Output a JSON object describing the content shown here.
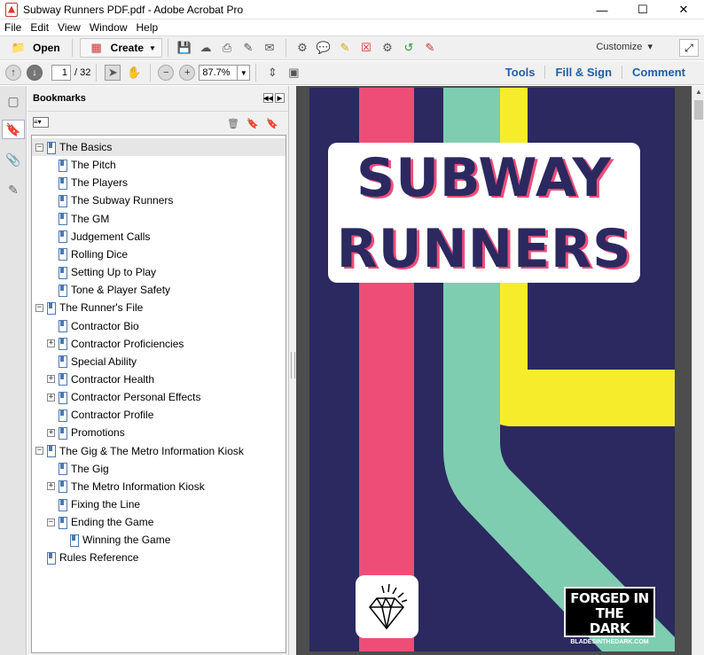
{
  "window": {
    "title": "Subway Runners PDF.pdf - Adobe Acrobat Pro"
  },
  "menu": [
    "File",
    "Edit",
    "View",
    "Window",
    "Help"
  ],
  "toolbar": {
    "open_label": "Open",
    "create_label": "Create",
    "customize_label": "Customize"
  },
  "nav": {
    "current_page": "1",
    "total_pages": "/ 32",
    "zoom": "87.7%"
  },
  "right_links": [
    "Tools",
    "Fill & Sign",
    "Comment"
  ],
  "bookmarks": {
    "title": "Bookmarks",
    "items": [
      {
        "label": "The Basics",
        "level": 0,
        "toggle": "-",
        "selected": true
      },
      {
        "label": "The Pitch",
        "level": 1,
        "toggle": ""
      },
      {
        "label": "The Players",
        "level": 1,
        "toggle": ""
      },
      {
        "label": "The Subway Runners",
        "level": 1,
        "toggle": ""
      },
      {
        "label": "The GM",
        "level": 1,
        "toggle": ""
      },
      {
        "label": "Judgement Calls",
        "level": 1,
        "toggle": ""
      },
      {
        "label": "Rolling Dice",
        "level": 1,
        "toggle": ""
      },
      {
        "label": "Setting Up to Play",
        "level": 1,
        "toggle": ""
      },
      {
        "label": "Tone & Player Safety",
        "level": 1,
        "toggle": ""
      },
      {
        "label": "The Runner's File",
        "level": 0,
        "toggle": "-"
      },
      {
        "label": "Contractor Bio",
        "level": 1,
        "toggle": ""
      },
      {
        "label": "Contractor Proficiencies",
        "level": 1,
        "toggle": "+"
      },
      {
        "label": "Special Ability",
        "level": 1,
        "toggle": ""
      },
      {
        "label": "Contractor Health",
        "level": 1,
        "toggle": "+"
      },
      {
        "label": "Contractor Personal Effects",
        "level": 1,
        "toggle": "+"
      },
      {
        "label": "Contractor Profile",
        "level": 1,
        "toggle": ""
      },
      {
        "label": "Promotions",
        "level": 1,
        "toggle": "+"
      },
      {
        "label": "The Gig & The Metro Information Kiosk",
        "level": 0,
        "toggle": "-"
      },
      {
        "label": "The Gig",
        "level": 1,
        "toggle": ""
      },
      {
        "label": "The Metro Information Kiosk",
        "level": 1,
        "toggle": "+"
      },
      {
        "label": "Fixing the Line",
        "level": 1,
        "toggle": ""
      },
      {
        "label": "Ending the Game",
        "level": 1,
        "toggle": "-"
      },
      {
        "label": "Winning the Game",
        "level": 2,
        "toggle": ""
      },
      {
        "label": "Rules Reference",
        "level": 0,
        "toggle": ""
      }
    ]
  },
  "cover": {
    "title_line1": "SUBWAY",
    "title_line2": "RUNNERS",
    "badge_line1": "FORGED IN THE",
    "badge_line2": "DARK",
    "badge_line3": "BLADESINTHEDARK.COM",
    "colors": {
      "background": "#2b2960",
      "pink": "#ee4d78",
      "teal": "#7fcdb1",
      "yellow": "#f7ec2c"
    }
  }
}
